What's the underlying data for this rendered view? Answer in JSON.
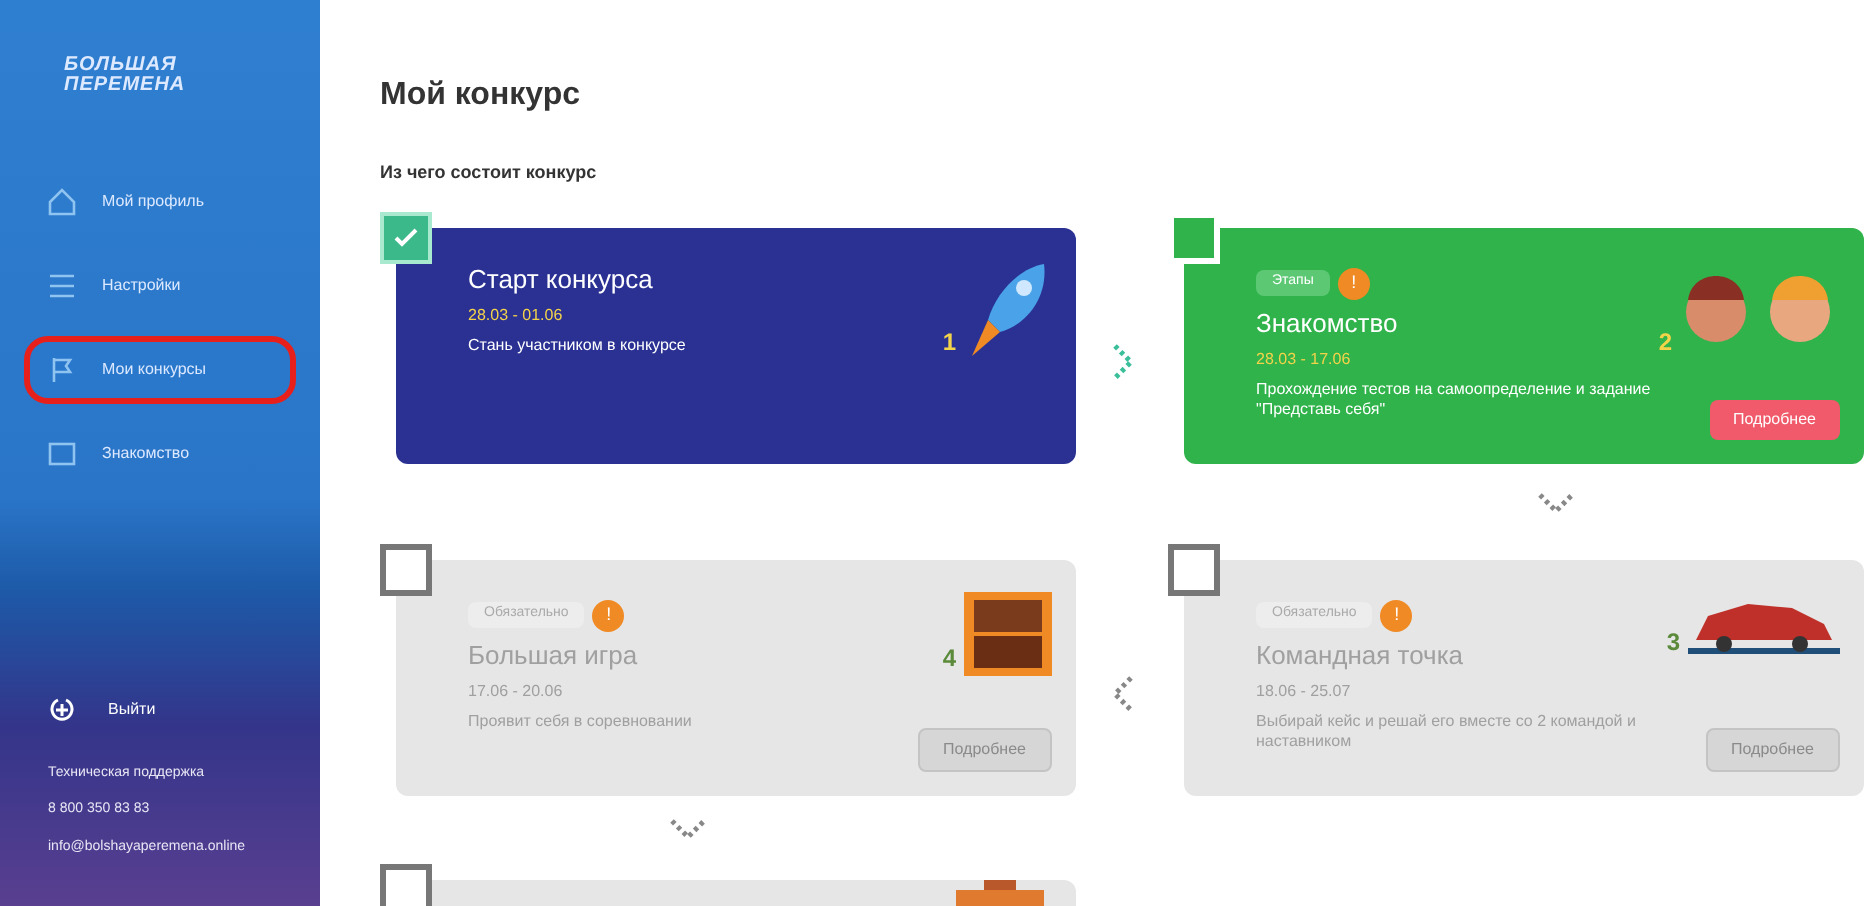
{
  "sidebar": {
    "logo": [
      "БОЛЬШАЯ",
      "ПЕРЕМЕНА"
    ],
    "items": [
      {
        "label": "Мой профиль",
        "selected": false
      },
      {
        "label": "Настройки",
        "selected": false
      },
      {
        "label": "Мои конкурсы",
        "selected": true
      },
      {
        "label": "Знакомство",
        "selected": false
      }
    ],
    "logout": "Выйти",
    "support_title": "Техническая поддержка",
    "support_phone": "8 800 350 83 83",
    "support_email": "info@bolshayaperemena.online"
  },
  "page": {
    "title": "Мой конкурс",
    "subtitle": "Из чего состоит конкурс"
  },
  "stages": [
    {
      "kind": "done",
      "checked": true,
      "title": "Старт конкурса",
      "dates": "28.03 - 01.06",
      "description": "Стань участником в конкурсе",
      "number": "1"
    },
    {
      "kind": "active",
      "checked": false,
      "badge": "Этапы",
      "badge_icon": "!",
      "title": "Знакомство",
      "dates": "28.03 - 17.06",
      "description": "Прохождение тестов на самоопределение и задание \"Представь себя\"",
      "number": "2",
      "button": {
        "label": "Подробнее",
        "disabled": false
      }
    },
    {
      "kind": "locked",
      "checked": false,
      "badge": "Обязательно",
      "badge_icon": "!",
      "title": "Большая игра",
      "dates": "17.06 - 20.06",
      "description": "Проявит себя в соревновании",
      "number": "4",
      "button": {
        "label": "Подробнее",
        "disabled": true
      }
    },
    {
      "kind": "locked",
      "checked": false,
      "badge": "Обязательно",
      "badge_icon": "!",
      "title": "Командная точка",
      "dates": "18.06 - 25.07",
      "description": "Выбирай кейс и решай его вместе со 2 командой и наставником",
      "number": "3",
      "button": {
        "label": "Подробнее",
        "disabled": true
      }
    },
    {
      "kind": "locked",
      "checked": false
    }
  ]
}
